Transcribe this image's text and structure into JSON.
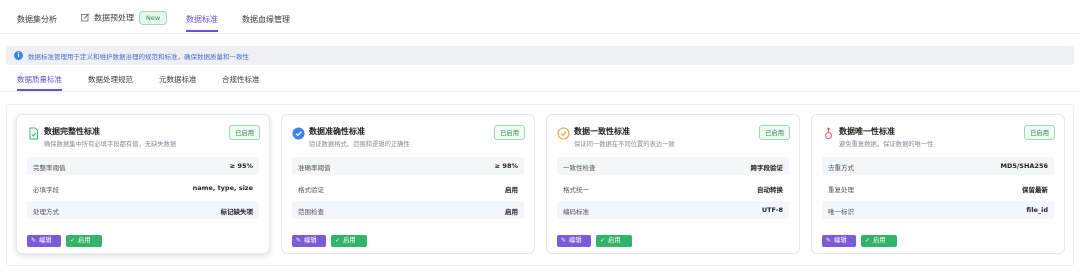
{
  "top_tabs": [
    {
      "label": "数据集分析"
    },
    {
      "label": "数据预处理",
      "badge": "New"
    },
    {
      "label": "数据标准"
    },
    {
      "label": "数据血缘管理"
    }
  ],
  "notice": {
    "text": "数据标准管理用于定义和维护数据治理的规范和标准，确保数据质量和一致性"
  },
  "sub_tabs": [
    {
      "label": "数据质量标准"
    },
    {
      "label": "数据处理规范"
    },
    {
      "label": "元数据标准"
    },
    {
      "label": "合规性标准"
    }
  ],
  "cards": [
    {
      "title": "数据完整性标准",
      "desc": "确保数据集中所有必填字段都有值，无缺失数据",
      "status": "已启用",
      "rows": [
        {
          "k": "完整率阈值",
          "v": "≥ 95%"
        },
        {
          "k": "必填字段",
          "v": "name, type, size"
        },
        {
          "k": "处理方式",
          "v": "标记缺失项"
        }
      ],
      "edit": "编辑",
      "enable": "启用"
    },
    {
      "title": "数据准确性标准",
      "desc": "验证数据格式、范围和逻辑的正确性",
      "status": "已启用",
      "rows": [
        {
          "k": "准确率阈值",
          "v": "≥ 98%"
        },
        {
          "k": "格式验证",
          "v": "启用"
        },
        {
          "k": "范围检查",
          "v": "启用"
        }
      ],
      "edit": "编辑",
      "enable": "启用"
    },
    {
      "title": "数据一致性标准",
      "desc": "保证同一数据在不同位置的表达一致",
      "status": "已启用",
      "rows": [
        {
          "k": "一致性检查",
          "v": "跨字段验证"
        },
        {
          "k": "格式统一",
          "v": "自动转换"
        },
        {
          "k": "编码标准",
          "v": "UTF-8"
        }
      ],
      "edit": "编辑",
      "enable": "启用"
    },
    {
      "title": "数据唯一性标准",
      "desc": "避免重复数据，保证数据的唯一性",
      "status": "已启用",
      "rows": [
        {
          "k": "去重方式",
          "v": "MD5/SHA256"
        },
        {
          "k": "重复处理",
          "v": "保留最新"
        },
        {
          "k": "唯一标识",
          "v": "file_id"
        }
      ],
      "edit": "编辑",
      "enable": "启用"
    }
  ],
  "colors": {
    "accent": "#6b4fd8",
    "success": "#34b36a",
    "info": "#3b82f6",
    "edit": "#7c5bd6"
  }
}
